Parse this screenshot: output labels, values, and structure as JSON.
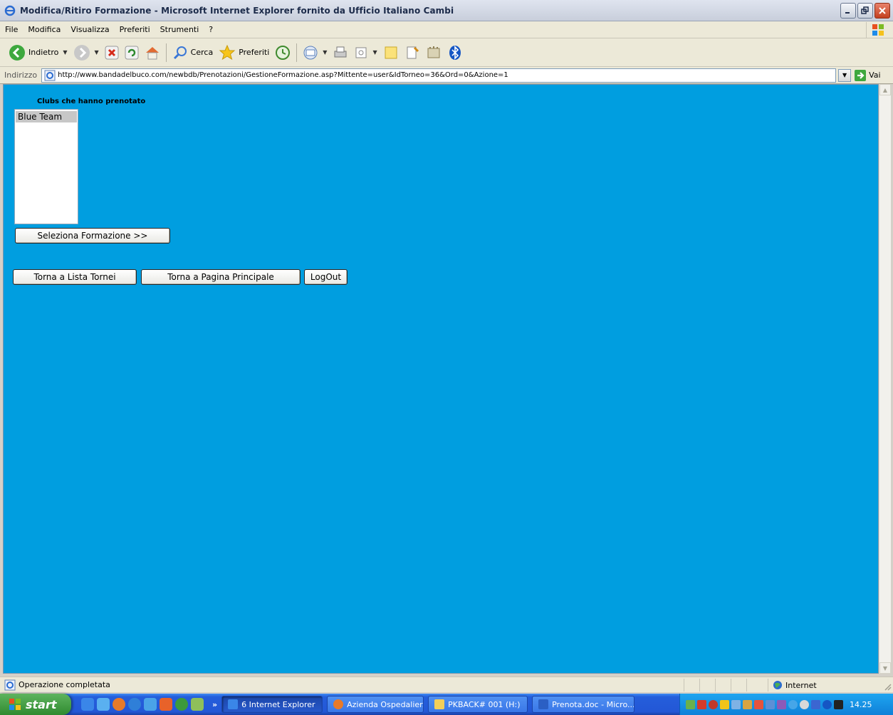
{
  "window": {
    "title": "Modifica/Ritiro Formazione - Microsoft Internet Explorer fornito da Ufficio Italiano Cambi"
  },
  "menubar": {
    "items": [
      "File",
      "Modifica",
      "Visualizza",
      "Preferiti",
      "Strumenti",
      "?"
    ]
  },
  "toolbar": {
    "back_label": "Indietro",
    "search_label": "Cerca",
    "favorites_label": "Preferiti"
  },
  "address": {
    "label": "Indirizzo",
    "url": "http://www.bandadelbuco.com/newbdb/Prenotazioni/GestioneFormazione.asp?Mittente=user&IdTorneo=36&Ord=0&Azione=1",
    "go_label": "Vai"
  },
  "page": {
    "section_title": "Clubs che hanno prenotato",
    "clubs": [
      "Blue Team"
    ],
    "select_button": "Seleziona Formazione >>",
    "back_tournaments_button": "Torna a Lista Tornei",
    "home_button": "Torna a Pagina Principale",
    "logout_button": "LogOut",
    "background_color": "#009ee0"
  },
  "statusbar": {
    "text": "Operazione completata",
    "zone": "Internet"
  },
  "taskbar": {
    "start_label": "start",
    "tasks": [
      {
        "label": "6 Internet Explorer",
        "active": true
      },
      {
        "label": "Azienda Ospedalier...",
        "active": false
      },
      {
        "label": "PKBACK# 001 (H:)",
        "active": false
      },
      {
        "label": "Prenota.doc - Micro...",
        "active": false
      }
    ],
    "clock": "14.25"
  }
}
